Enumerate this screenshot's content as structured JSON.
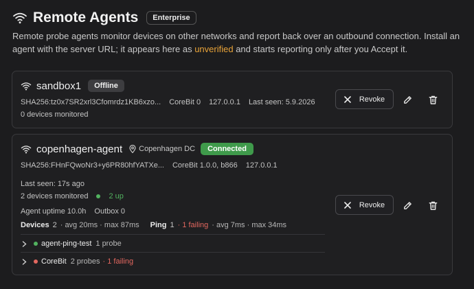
{
  "page": {
    "title": "Remote Agents",
    "badge": "Enterprise",
    "description_before": "Remote probe agents monitor devices on other networks and report back over an outbound connection. Install an agent with the server URL; it appears here as ",
    "description_highlight": "unverified",
    "description_after": " and starts reporting only after you Accept it."
  },
  "colors": {
    "background": "#1c1c1e",
    "card_border": "#3a3a3d",
    "connected": "#3f9a4b",
    "warning": "#e8a339",
    "failing": "#e2675f"
  },
  "agents": [
    {
      "name": "sandbox1",
      "status": "Offline",
      "fingerprint": "SHA256:tz0x7SR2xrl3Cfomrdz1KB6xzo...",
      "version": "CoreBit 0",
      "ip": "127.0.0.1",
      "last_seen": "Last seen: 5.9.2026",
      "devices_monitored": "0 devices monitored",
      "revoke_label": "Revoke"
    },
    {
      "name": "copenhagen-agent",
      "location": "Copenhagen DC",
      "status": "Connected",
      "fingerprint": "SHA256:FHnFQwoNr3+y6PR80hfYATXe...",
      "version": "CoreBit 1.0.0, b866",
      "ip": "127.0.0.1",
      "last_seen": "Last seen: 17s ago",
      "devices_monitored": "2 devices monitored",
      "devices_up": "2 up",
      "uptime": "Agent uptime 10.0h",
      "outbox": "Outbox 0",
      "devices_summary": {
        "label": "Devices",
        "count": "2",
        "detail": "· avg 20ms · max 87ms"
      },
      "ping_summary": {
        "label": "Ping",
        "count": "1",
        "failing": "· 1 failing",
        "detail": "· avg 7ms · max 34ms"
      },
      "probes": [
        {
          "name": "agent-ping-test",
          "count": "1 probe",
          "failing": "",
          "status": "ok"
        },
        {
          "name": "CoreBit",
          "count": "2 probes",
          "failing": "· 1 failing",
          "status": "failing"
        }
      ],
      "revoke_label": "Revoke"
    }
  ]
}
